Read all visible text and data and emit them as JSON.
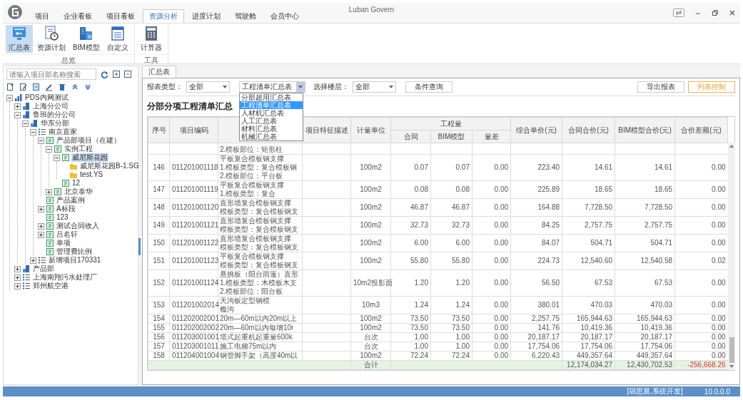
{
  "window": {
    "title": "Luban Govern"
  },
  "menu_tabs": [
    {
      "label": "项目",
      "selected": false
    },
    {
      "label": "企业看板",
      "selected": false
    },
    {
      "label": "项目看板",
      "selected": false
    },
    {
      "label": "资源分析",
      "selected": true
    },
    {
      "label": "进度计划",
      "selected": false
    },
    {
      "label": "驾驶舱",
      "selected": false
    },
    {
      "label": "会员中心",
      "selected": false
    }
  ],
  "ribbon": {
    "groups": [
      {
        "label": "总览",
        "buttons": [
          {
            "kind": "summary",
            "label": "汇总表",
            "selected": true
          },
          {
            "kind": "plan",
            "label": "资源计划",
            "selected": false
          },
          {
            "kind": "bim",
            "label": "BIM模型",
            "selected": false
          },
          {
            "kind": "custom",
            "label": "自定义",
            "selected": false
          }
        ]
      },
      {
        "label": "工具",
        "buttons": [
          {
            "kind": "calculator",
            "label": "计算器",
            "selected": false
          }
        ]
      }
    ]
  },
  "sidebar": {
    "search": {
      "placeholder": "请输入项目部名称搜索"
    },
    "tree": [
      {
        "label": "PDS内网测试",
        "kind": "root",
        "selected": false,
        "expanded": true,
        "children": [
          {
            "label": "上海分公司",
            "kind": "company",
            "selected": false,
            "expanded": false
          },
          {
            "label": "鲁班的分公司",
            "kind": "company",
            "selected": false,
            "expanded": true,
            "children": [
              {
                "label": "华东分部",
                "kind": "company",
                "selected": false,
                "expanded": true,
                "children": [
                  {
                    "label": "南京直家",
                    "kind": "group",
                    "selected": false,
                    "expanded": true,
                    "children": [
                      {
                        "label": "产品部项目（在建）",
                        "kind": "project",
                        "selected": false,
                        "expanded": true,
                        "children": [
                          {
                            "label": "实例工程",
                            "kind": "project",
                            "selected": false,
                            "expanded": true,
                            "children": [
                              {
                                "label": "威尼斯花园",
                                "kind": "project",
                                "selected": true,
                                "expanded": true,
                                "children": [
                                  {
                                    "label": "威尼斯花园B-1.SG",
                                    "kind": "file",
                                    "selected": false
                                  },
                                  {
                                    "label": "test.YS",
                                    "kind": "file",
                                    "selected": false
                                  }
                                ]
                              },
                              {
                                "label": "12",
                                "kind": "project",
                                "selected": false
                              }
                            ]
                          },
                          {
                            "label": "北京泰华",
                            "kind": "project",
                            "selected": false,
                            "expanded": false
                          }
                        ]
                      },
                      {
                        "label": "产品案例",
                        "kind": "project",
                        "selected": false
                      },
                      {
                        "label": "A标段",
                        "kind": "project",
                        "selected": false,
                        "expanded": false
                      },
                      {
                        "label": "123",
                        "kind": "project",
                        "selected": false
                      },
                      {
                        "label": "测试合同收入",
                        "kind": "project",
                        "selected": false,
                        "expanded": false
                      },
                      {
                        "label": "吕名轩",
                        "kind": "project",
                        "selected": false,
                        "expanded": false
                      },
                      {
                        "label": "单项",
                        "kind": "project",
                        "selected": false
                      },
                      {
                        "label": "管理费比例",
                        "kind": "project",
                        "selected": false
                      }
                    ]
                  },
                  {
                    "label": "新增项目170331",
                    "kind": "group",
                    "selected": false,
                    "expanded": false
                  }
                ]
              }
            ]
          },
          {
            "label": "产品部",
            "kind": "company",
            "selected": false,
            "expanded": false
          },
          {
            "label": "上海南翔污水处理厂",
            "kind": "group",
            "selected": false,
            "expanded": false
          },
          {
            "label": "郑州航空港",
            "kind": "group",
            "selected": false,
            "expanded": false
          }
        ]
      }
    ]
  },
  "document_tabs": [
    {
      "label": "汇总表",
      "selected": true
    }
  ],
  "filters": {
    "report_type_label": "报表类型：",
    "report_type": "全部",
    "report_select": {
      "value": "工程清单汇总表",
      "open": true,
      "options": [
        {
          "label": "分部超用汇总表",
          "selected": false
        },
        {
          "label": "工程清单汇总表",
          "selected": true
        },
        {
          "label": "人材机汇总表",
          "selected": false
        },
        {
          "label": "人工汇总表",
          "selected": false
        },
        {
          "label": "材料汇总表",
          "selected": false
        },
        {
          "label": "机械汇总表",
          "selected": false
        }
      ]
    },
    "floor_label": "选择楼层：",
    "floor": "全部",
    "query_button": "条件查询",
    "export_button": "导出报表",
    "column_button": "列表控制"
  },
  "report_title": "分部分项工程清单汇总",
  "table": {
    "columns": [
      {
        "label": "序号"
      },
      {
        "label": "项目编码"
      },
      {},
      {
        "label": "项目特征描述"
      },
      {
        "label": "计量单位"
      },
      {
        "label": "工程量",
        "children": [
          {
            "label": "合同"
          },
          {
            "label": "BIM模型"
          },
          {
            "label": "量差"
          }
        ]
      },
      {
        "label": "综合单价(元)"
      },
      {
        "label": "合同合价(元)"
      },
      {
        "label": "BIM模型合价(元)"
      },
      {
        "label": "合价差额(元)"
      }
    ],
    "rows": [
      {
        "name_lines": [
          "2.模板部位：矩形柱"
        ]
      },
      {
        "no": "146",
        "code": "011201001118",
        "name_lines": [
          "平板复合模板钢支撑",
          "1.模板类型：复合模板钢",
          "2.模板部位：平台板"
        ],
        "unit": "100m2",
        "qty_contract": "0.07",
        "qty_bim": "0.07",
        "qty_diff": "0.00",
        "unit_price": "223.40",
        "contract_total": "14.61",
        "bim_total": "14.61",
        "total_diff": "0.00"
      },
      {
        "no": "147",
        "code": "011201001119",
        "name_lines": [
          "平板复合模板钢支撑",
          "1.模板类型：复合"
        ],
        "unit": "100m2",
        "qty_contract": "0.08",
        "qty_bim": "0.08",
        "qty_diff": "0.00",
        "unit_price": "225.89",
        "contract_total": "18.65",
        "bim_total": "18.65",
        "total_diff": "0.00"
      },
      {
        "no": "148",
        "code": "011201001120",
        "name_lines": [
          "直形墙复合模板钢支撑",
          "模板类型：复合模板钢支"
        ],
        "unit": "100m2",
        "qty_contract": "46.87",
        "qty_bim": "46.87",
        "qty_diff": "0.00",
        "unit_price": "164.88",
        "contract_total": "7,728.50",
        "bim_total": "7,728.50",
        "total_diff": "0.00"
      },
      {
        "no": "149",
        "code": "011201001121",
        "name_lines": [
          "直形墙复合模板钢支撑",
          "模板类型：复合模板钢支"
        ],
        "unit": "100m2",
        "qty_contract": "32.73",
        "qty_bim": "32.73",
        "qty_diff": "0.00",
        "unit_price": "84.25",
        "contract_total": "2,757.75",
        "bim_total": "2,757.75",
        "total_diff": "0.00"
      },
      {
        "no": "150",
        "code": "011201001122",
        "name_lines": [
          "直形墙复合模板钢支撑",
          "模板类型：复合模板钢支"
        ],
        "unit": "100m2",
        "qty_contract": "6.00",
        "qty_bim": "6.00",
        "qty_diff": "0.00",
        "unit_price": "84.07",
        "contract_total": "504.71",
        "bim_total": "504.71",
        "total_diff": "0.00"
      },
      {
        "no": "151",
        "code": "011201001123",
        "name_lines": [
          "平板复合模板钢支撑",
          "模板类型：复合模板钢支"
        ],
        "unit": "100m2",
        "qty_contract": "55.80",
        "qty_bim": "55.80",
        "qty_diff": "0.00",
        "unit_price": "224.73",
        "contract_total": "12,540.60",
        "bim_total": "12,540.58",
        "total_diff": "0.02"
      },
      {
        "no": "152",
        "code": "011201001124",
        "name_lines": [
          "悬挑板（阳台雨篷）直形",
          "1.模板类型：木模板木支",
          "2.模板部位：阳台板"
        ],
        "unit": "10m2投影面",
        "qty_contract": "1.20",
        "qty_bim": "1.20",
        "qty_diff": "0.00",
        "unit_price": "56.50",
        "contract_total": "67.53",
        "bim_total": "67.53",
        "total_diff": "0.00"
      },
      {
        "no": "153",
        "code": "011201002014",
        "name_lines": [
          "天沟板定型钢模",
          "檐沟"
        ],
        "unit": "10m3",
        "qty_contract": "1.24",
        "qty_bim": "1.24",
        "qty_diff": "0.00",
        "unit_price": "380.01",
        "contract_total": "470.03",
        "bim_total": "470.03",
        "total_diff": "0.00"
      },
      {
        "no": "154",
        "code": "011202002001",
        "name_lines": [
          "20m—60m以内20m以上"
        ],
        "unit": "100m2",
        "qty_contract": "73.50",
        "qty_bim": "73.50",
        "qty_diff": "0.00",
        "unit_price": "2,257.75",
        "contract_total": "165,944.63",
        "bim_total": "165,944.63",
        "total_diff": "0.00"
      },
      {
        "no": "155",
        "code": "011202002002",
        "name_lines": [
          "20m—60m以内每增10r"
        ],
        "unit": "100m2",
        "qty_contract": "73.50",
        "qty_bim": "73.50",
        "qty_diff": "0.00",
        "unit_price": "141.76",
        "contract_total": "10,419.36",
        "bim_total": "10,419.36",
        "total_diff": "0.00"
      },
      {
        "no": "156",
        "code": "011203001001",
        "name_lines": [
          "塔式起重机起重量600k"
        ],
        "unit": "台次",
        "qty_contract": "1.00",
        "qty_bim": "1.00",
        "qty_diff": "0.00",
        "unit_price": "20,187.17",
        "contract_total": "20,187.17",
        "bim_total": "20,187.17",
        "total_diff": "0.00"
      },
      {
        "no": "157",
        "code": "011203001011",
        "name_lines": [
          "施工电梯75m以内"
        ],
        "unit": "台次",
        "qty_contract": "1.00",
        "qty_bim": "1.00",
        "qty_diff": "0.00",
        "unit_price": "17,754.06",
        "contract_total": "17,754.06",
        "bim_total": "17,754.06",
        "total_diff": "0.00"
      },
      {
        "no": "158",
        "code": "011204001004",
        "name_lines": [
          "钢管脚手架（高度40m以"
        ],
        "unit": "100m2",
        "qty_contract": "72.24",
        "qty_bim": "72.24",
        "qty_diff": "0.00",
        "unit_price": "6,220.43",
        "contract_total": "449,357.64",
        "bim_total": "449,357.64",
        "total_diff": "0.00"
      }
    ],
    "total": {
      "label": "合计",
      "contract_total": "12,174,034.27",
      "bim_total": "12,430,702.53",
      "total_diff": "-256,668.26",
      "negative": true
    }
  },
  "status_bar": {
    "user": "[胡思晨,系统开发]",
    "version": "10.0.0.0"
  }
}
